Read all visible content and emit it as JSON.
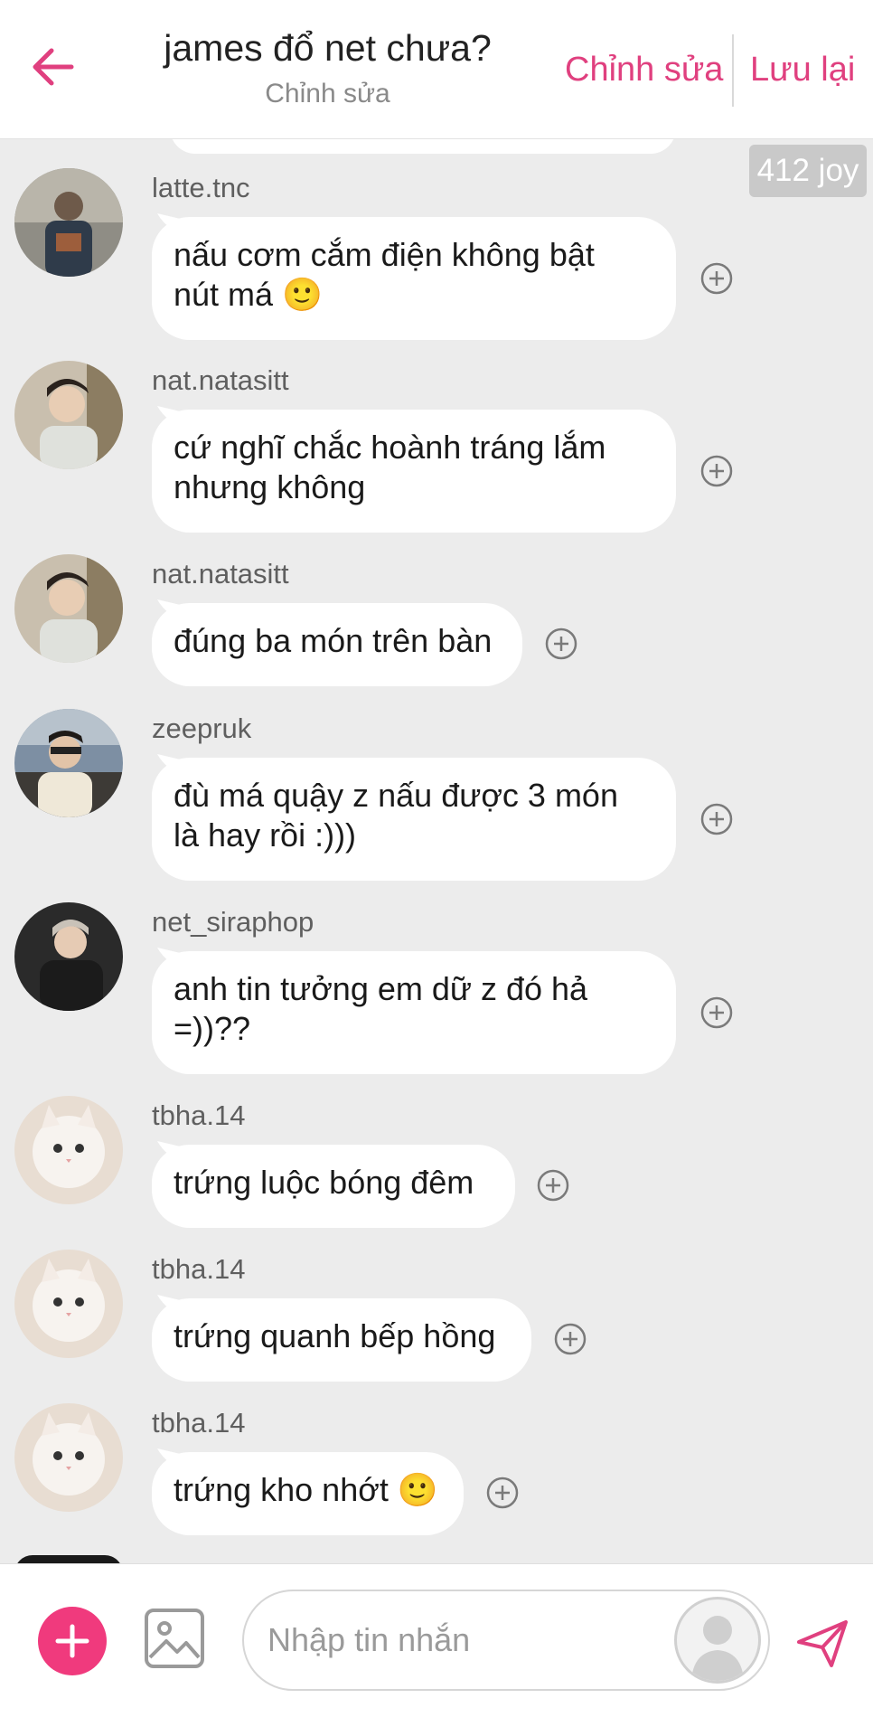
{
  "header": {
    "title": "james đổ net chưa?",
    "subtitle": "Chỉnh sửa",
    "edit_label": "Chỉnh sửa",
    "save_label": "Lưu lại",
    "back_icon": "arrow-left-icon"
  },
  "badge": {
    "text": "412 joy"
  },
  "colors": {
    "accent": "#e0407f",
    "add_button": "#f03a7d",
    "background": "#ececec",
    "bubble": "#ffffff"
  },
  "messages": [
    {
      "user": "latte.tnc",
      "lines": [
        "nấu cơm cắm điện không bật",
        "nút má 🙂"
      ]
    },
    {
      "user": "nat.natasitt",
      "lines": [
        "cứ nghĩ chắc hoành tráng lắm",
        "nhưng không"
      ]
    },
    {
      "user": "nat.natasitt",
      "lines": [
        "đúng ba món trên bàn"
      ]
    },
    {
      "user": "zeepruk",
      "lines": [
        "đù má quậy z nấu được 3 món",
        "là hay rồi :)))"
      ]
    },
    {
      "user": "net_siraphop",
      "lines": [
        "anh tin tưởng em dữ z đó hả",
        "=))??"
      ]
    },
    {
      "user": "tbha.14",
      "lines": [
        "trứng luộc bóng đêm"
      ]
    },
    {
      "user": "tbha.14",
      "lines": [
        "trứng quanh bếp hồng"
      ]
    },
    {
      "user": "tbha.14",
      "lines": [
        "trứng kho nhớt 🙂"
      ]
    }
  ],
  "composer": {
    "placeholder": "Nhập tin nhắn",
    "add_icon": "plus-icon",
    "image_icon": "image-icon",
    "send_icon": "send-icon"
  }
}
